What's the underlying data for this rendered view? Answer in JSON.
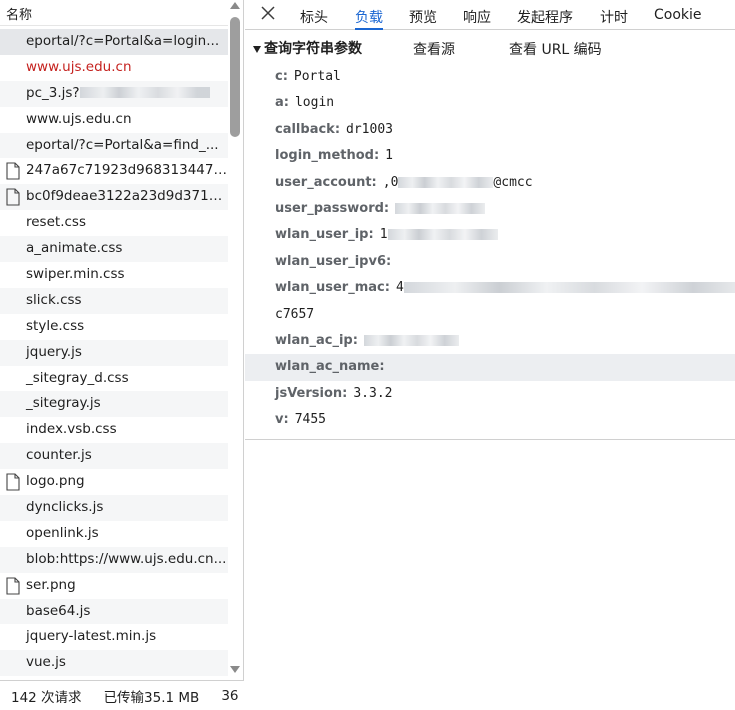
{
  "list": {
    "header": "名称",
    "rows": [
      {
        "label": "eportal/?c=Portal&a=login...",
        "selected": true,
        "icon": false,
        "red": false,
        "blur": false
      },
      {
        "label": "www.ujs.edu.cn",
        "selected": false,
        "icon": false,
        "red": true,
        "blur": false
      },
      {
        "label": "pc_3.js?",
        "selected": false,
        "icon": false,
        "red": false,
        "blur": true
      },
      {
        "label": "www.ujs.edu.cn",
        "selected": false,
        "icon": false,
        "red": false,
        "blur": false
      },
      {
        "label": "eportal/?c=Portal&a=find_...",
        "selected": false,
        "icon": false,
        "red": false,
        "blur": false
      },
      {
        "label": "247a67c71923d9683134473...",
        "selected": false,
        "icon": true,
        "red": false,
        "blur": false
      },
      {
        "label": "bc0f9deae3122a23d9d371a...",
        "selected": false,
        "icon": true,
        "red": false,
        "blur": false
      },
      {
        "label": "reset.css",
        "selected": false,
        "icon": false,
        "red": false,
        "blur": false
      },
      {
        "label": "a_animate.css",
        "selected": false,
        "icon": false,
        "red": false,
        "blur": false
      },
      {
        "label": "swiper.min.css",
        "selected": false,
        "icon": false,
        "red": false,
        "blur": false
      },
      {
        "label": "slick.css",
        "selected": false,
        "icon": false,
        "red": false,
        "blur": false
      },
      {
        "label": "style.css",
        "selected": false,
        "icon": false,
        "red": false,
        "blur": false
      },
      {
        "label": "jquery.js",
        "selected": false,
        "icon": false,
        "red": false,
        "blur": false
      },
      {
        "label": "_sitegray_d.css",
        "selected": false,
        "icon": false,
        "red": false,
        "blur": false
      },
      {
        "label": "_sitegray.js",
        "selected": false,
        "icon": false,
        "red": false,
        "blur": false
      },
      {
        "label": "index.vsb.css",
        "selected": false,
        "icon": false,
        "red": false,
        "blur": false
      },
      {
        "label": "counter.js",
        "selected": false,
        "icon": false,
        "red": false,
        "blur": false
      },
      {
        "label": "logo.png",
        "selected": false,
        "icon": true,
        "red": false,
        "blur": false
      },
      {
        "label": "dynclicks.js",
        "selected": false,
        "icon": false,
        "red": false,
        "blur": false
      },
      {
        "label": "openlink.js",
        "selected": false,
        "icon": false,
        "red": false,
        "blur": false
      },
      {
        "label": "blob:https://www.ujs.edu.cn...",
        "selected": false,
        "icon": false,
        "red": false,
        "blur": false
      },
      {
        "label": "ser.png",
        "selected": false,
        "icon": true,
        "red": false,
        "blur": false
      },
      {
        "label": "base64.js",
        "selected": false,
        "icon": false,
        "red": false,
        "blur": false
      },
      {
        "label": "jquery-latest.min.js",
        "selected": false,
        "icon": false,
        "red": false,
        "blur": false
      },
      {
        "label": "vue.js",
        "selected": false,
        "icon": false,
        "red": false,
        "blur": false
      }
    ]
  },
  "status": {
    "requests": "142 次请求",
    "transferred": "已传输35.1 MB",
    "more": "36"
  },
  "tabs": [
    "标头",
    "负载",
    "预览",
    "响应",
    "发起程序",
    "计时",
    "Cookie"
  ],
  "active_tab": "负载",
  "payload": {
    "section_title": "查询字符串参数",
    "view_source": "查看源",
    "view_url_encoded": "查看 URL 编码",
    "params": [
      {
        "key": "c:",
        "value": "Portal"
      },
      {
        "key": "a:",
        "value": "login"
      },
      {
        "key": "callback:",
        "value": "dr1003"
      },
      {
        "key": "login_method:",
        "value": "1"
      },
      {
        "key": "user_account:",
        "value": ",0",
        "value_suffix": "@cmcc",
        "blur": 95
      },
      {
        "key": "user_password:",
        "value": "",
        "blur": 90
      },
      {
        "key": "wlan_user_ip:",
        "value": "1",
        "blur": 110
      },
      {
        "key": "wlan_user_ipv6:",
        "value": ""
      },
      {
        "key": "wlan_user_mac:",
        "value": "4",
        "blur": 340
      },
      {
        "key": "",
        "value": "c7657"
      },
      {
        "key": "wlan_ac_ip:",
        "value": "",
        "blur": 95
      },
      {
        "key": "wlan_ac_name:",
        "value": "",
        "highlight": true
      },
      {
        "key": "jsVersion:",
        "value": "3.3.2"
      },
      {
        "key": "v:",
        "value": "7455"
      }
    ]
  },
  "colors": {
    "accent": "#1a66d2",
    "error": "#c5221f",
    "selected_row": "#e5e7ea"
  }
}
